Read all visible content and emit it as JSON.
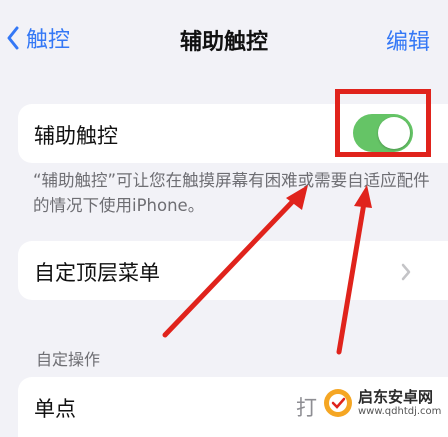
{
  "nav": {
    "back_label": "触控",
    "title": "辅助触控",
    "edit_label": "编辑"
  },
  "assistive_touch": {
    "label": "辅助触控",
    "toggle_on": true,
    "footnote": "“辅助触控”可让您在触摸屏幕有困难或需要自适应配件的情况下使用iPhone。"
  },
  "top_level_menu": {
    "label": "自定顶层菜单"
  },
  "custom_actions": {
    "header": "自定操作",
    "single_tap": {
      "label": "单点",
      "value_partial": "打"
    }
  },
  "watermark": {
    "name": "启东安卓网",
    "url": "www.qdhtdj.com"
  },
  "colors": {
    "accent": "#3478f6",
    "toggle_on": "#65c466",
    "annotation_red": "#e0231c",
    "background": "#f2f2f7"
  },
  "icons": [
    "chevron-left-icon",
    "chevron-right-icon",
    "watermark-logo-icon"
  ]
}
